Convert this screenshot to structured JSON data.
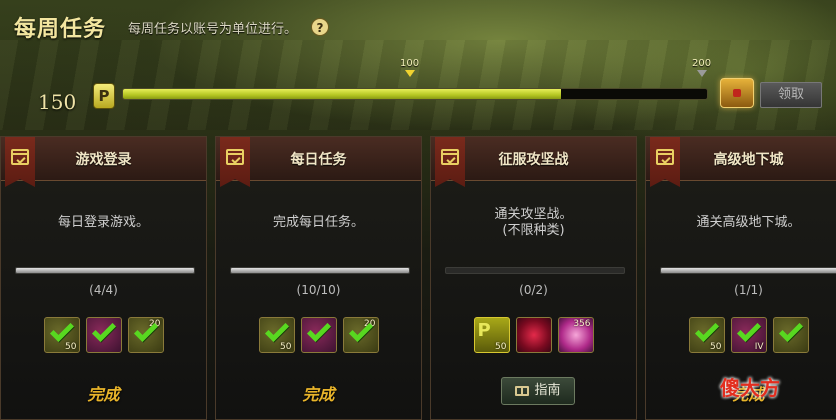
{
  "header": {
    "title": "每周任务",
    "subtitle": "每周任务以账号为单位进行。",
    "help_icon": "?"
  },
  "progress": {
    "current_score": "150",
    "points_icon": "P",
    "fraction_of_max": 0.75,
    "marker_mid": "100",
    "marker_end": "200",
    "claim_label": "领取"
  },
  "cards": [
    {
      "title": "游戏登录",
      "description": "每日登录游戏。",
      "count": "(4/4)",
      "fraction": 1.0,
      "rewards": [
        {
          "kind": "gold",
          "qty": "50",
          "checked": true
        },
        {
          "kind": "purple",
          "qty": "",
          "checked": true
        },
        {
          "kind": "gold",
          "qty": "20",
          "checked": true
        }
      ],
      "status": "完成"
    },
    {
      "title": "每日任务",
      "description": "完成每日任务。",
      "count": "(10/10)",
      "fraction": 1.0,
      "rewards": [
        {
          "kind": "gold",
          "qty": "50",
          "checked": true
        },
        {
          "kind": "purple",
          "qty": "",
          "checked": true
        },
        {
          "kind": "gold",
          "qty": "20",
          "checked": true
        }
      ],
      "status": "完成"
    },
    {
      "title": "征服攻坚战",
      "description": "通关攻坚战。\n(不限种类)",
      "count": "(0/2)",
      "fraction": 0,
      "rewards": [
        {
          "kind": "ppoint",
          "qty": "50",
          "checked": false
        },
        {
          "kind": "crimson",
          "qty": "",
          "checked": false
        },
        {
          "kind": "pink",
          "qty": "356",
          "checked": false
        }
      ],
      "guide_label": "指南"
    },
    {
      "title": "高级地下城",
      "description": "通关高级地下城。",
      "count": "(1/1)",
      "fraction": 1.0,
      "rewards": [
        {
          "kind": "gold",
          "qty": "50",
          "checked": true
        },
        {
          "kind": "purple",
          "qty": "IV",
          "checked": true
        },
        {
          "kind": "gold",
          "qty": "",
          "checked": true
        }
      ],
      "status": "完成"
    }
  ],
  "watermark": "傻大方"
}
